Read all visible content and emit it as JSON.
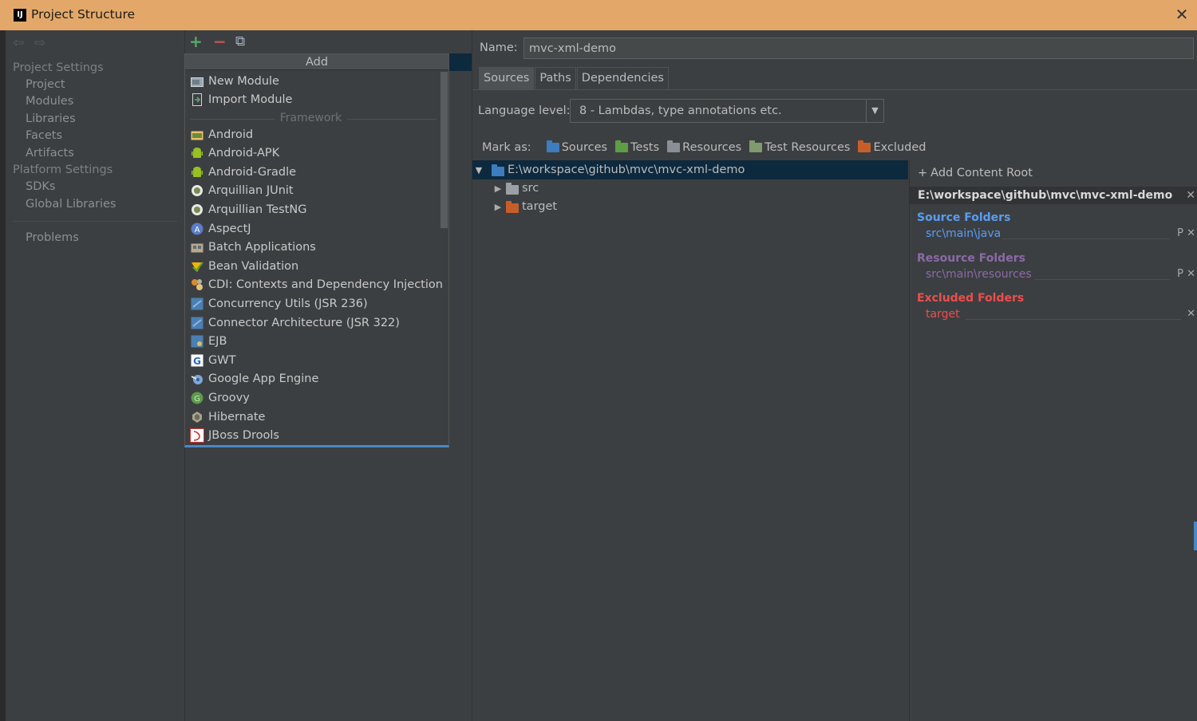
{
  "window": {
    "title": "Project Structure",
    "close_glyph": "✕",
    "app_icon_text": "IJ"
  },
  "nav": {
    "back": "⇦",
    "forward": "⇨"
  },
  "sidebar": {
    "project_settings": "Project Settings",
    "project_items": [
      "Project",
      "Modules",
      "Libraries",
      "Facets",
      "Artifacts"
    ],
    "platform_settings": "Platform Settings",
    "platform_items": [
      "SDKs",
      "Global Libraries"
    ],
    "problems": "Problems"
  },
  "toolbar": {
    "add": "+",
    "remove": "−",
    "copy": "⧉"
  },
  "add_popup": {
    "header": "Add",
    "top_items": [
      "New Module",
      "Import Module"
    ],
    "framework_label": "Framework",
    "frameworks": [
      {
        "label": "Android",
        "icon": "android-folder-icon"
      },
      {
        "label": "Android-APK",
        "icon": "android-icon"
      },
      {
        "label": "Android-Gradle",
        "icon": "android-icon"
      },
      {
        "label": "Arquillian JUnit",
        "icon": "arquillian-icon"
      },
      {
        "label": "Arquillian TestNG",
        "icon": "arquillian-icon"
      },
      {
        "label": "AspectJ",
        "icon": "aspectj-icon"
      },
      {
        "label": "Batch Applications",
        "icon": "batch-icon"
      },
      {
        "label": "Bean Validation",
        "icon": "bean-validation-icon"
      },
      {
        "label": "CDI: Contexts and Dependency Injection",
        "icon": "cdi-icon"
      },
      {
        "label": "Concurrency Utils (JSR 236)",
        "icon": "javaee-icon"
      },
      {
        "label": "Connector Architecture (JSR 322)",
        "icon": "javaee-icon"
      },
      {
        "label": "EJB",
        "icon": "ejb-icon"
      },
      {
        "label": "GWT",
        "icon": "gwt-icon"
      },
      {
        "label": "Google App Engine",
        "icon": "app-engine-icon"
      },
      {
        "label": "Groovy",
        "icon": "groovy-icon"
      },
      {
        "label": "Hibernate",
        "icon": "hibernate-icon"
      },
      {
        "label": "JBoss Drools",
        "icon": "drools-icon"
      }
    ]
  },
  "module": {
    "name_label": "Name:",
    "name_value": "mvc-xml-demo",
    "tabs": [
      "Sources",
      "Paths",
      "Dependencies"
    ],
    "language_label": "Language level:",
    "language_value": "8 - Lambdas, type annotations etc.",
    "mark_as_label": "Mark as:",
    "mark_as": [
      {
        "label": "Sources",
        "color": "#3d7cbf"
      },
      {
        "label": "Tests",
        "color": "#5e9c45"
      },
      {
        "label": "Resources",
        "color": "#8a8f96"
      },
      {
        "label": "Test Resources",
        "color": "#7f9a6e"
      },
      {
        "label": "Excluded",
        "color": "#c75e2a"
      }
    ],
    "tree": {
      "root": "E:\\workspace\\github\\mvc\\mvc-xml-demo",
      "children": [
        "src",
        "target"
      ]
    }
  },
  "content_roots": {
    "add_label": "Add Content Root",
    "root_path": "E:\\workspace\\github\\mvc\\mvc-xml-demo",
    "source_title": "Source Folders",
    "source_item": "src\\main\\java",
    "resource_title": "Resource Folders",
    "resource_item": "src\\main\\resources",
    "excluded_title": "Excluded Folders",
    "excluded_item": "target",
    "colors": {
      "source": "#589df6",
      "resource": "#8b6aa8",
      "excluded": "#ee4d4d"
    }
  },
  "colors": {
    "titlebar": "#e3a869",
    "selection": "#0d293e",
    "accent": "#4a88c7"
  }
}
